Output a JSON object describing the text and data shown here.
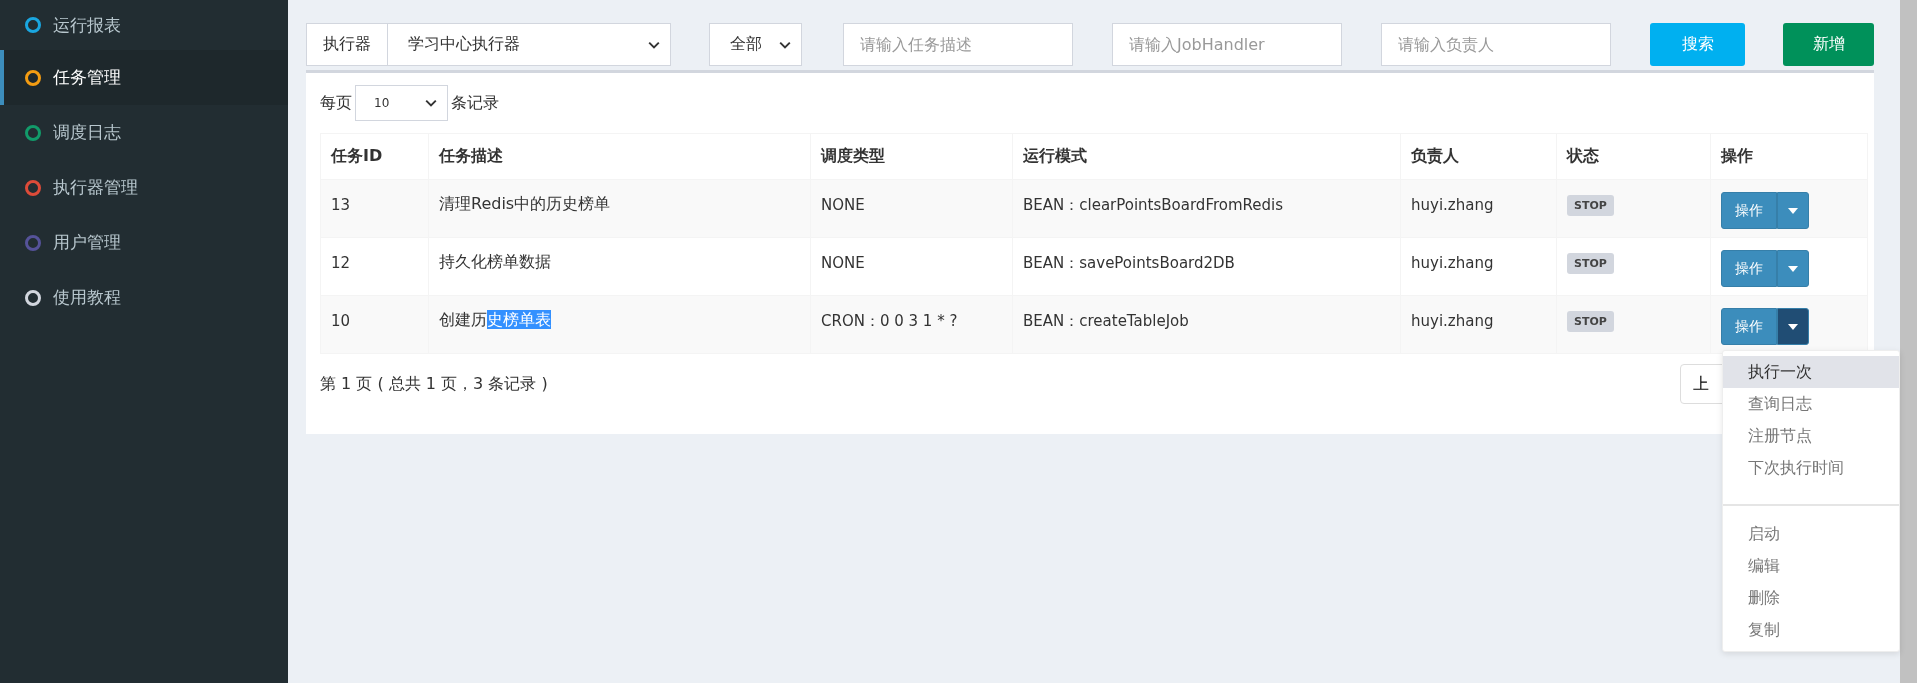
{
  "sidebar": {
    "items": [
      {
        "label": "运行报表",
        "color": "#1aa6e0",
        "selected": false
      },
      {
        "label": "任务管理",
        "color": "#f39c12",
        "selected": true
      },
      {
        "label": "调度日志",
        "color": "#129b6a",
        "selected": false
      },
      {
        "label": "执行器管理",
        "color": "#dd4b39",
        "selected": false
      },
      {
        "label": "用户管理",
        "color": "#555299",
        "selected": false
      },
      {
        "label": "使用教程",
        "color": "#d2d6de",
        "selected": false
      }
    ]
  },
  "filters": {
    "executor_label": "执行器",
    "executor_value": "学习中心执行器",
    "status_value": "全部",
    "desc_placeholder": "请输入任务描述",
    "handler_placeholder": "请输入JobHandler",
    "author_placeholder": "请输入负责人",
    "search_button": "搜索",
    "add_button": "新增"
  },
  "page_size": {
    "prefix": "每页",
    "value": "10",
    "suffix": "条记录"
  },
  "table": {
    "columns": [
      "任务ID",
      "任务描述",
      "调度类型",
      "运行模式",
      "负责人",
      "状态",
      "操作"
    ],
    "rows": [
      {
        "id": "13",
        "desc": "清理Redis中的历史榜单",
        "desc_selected": "",
        "schedule": "NONE",
        "mode": "BEAN：clearPointsBoardFromRedis",
        "author": "huyi.zhang",
        "status": "STOP",
        "action": "操作",
        "menu_open": false
      },
      {
        "id": "12",
        "desc": "持久化榜单数据",
        "desc_selected": "",
        "schedule": "NONE",
        "mode": "BEAN：savePointsBoard2DB",
        "author": "huyi.zhang",
        "status": "STOP",
        "action": "操作",
        "menu_open": false
      },
      {
        "id": "10",
        "desc": "创建历",
        "desc_selected": "史榜单表",
        "schedule": "CRON：0 0 3 1 * ?",
        "mode": "BEAN：createTableJob",
        "author": "huyi.zhang",
        "status": "STOP",
        "action": "操作",
        "menu_open": true
      }
    ]
  },
  "pagination": {
    "info": "第 1 页 ( 总共 1 页，3 条记录 )",
    "prev_button": "上"
  },
  "action_menu": {
    "groups": [
      [
        {
          "label": "执行一次",
          "highlighted": true
        },
        {
          "label": "查询日志",
          "highlighted": false
        },
        {
          "label": "注册节点",
          "highlighted": false
        },
        {
          "label": "下次执行时间",
          "highlighted": false
        }
      ],
      [
        {
          "label": "启动",
          "highlighted": false
        },
        {
          "label": "编辑",
          "highlighted": false
        },
        {
          "label": "删除",
          "highlighted": false
        },
        {
          "label": "复制",
          "highlighted": false
        }
      ]
    ]
  }
}
